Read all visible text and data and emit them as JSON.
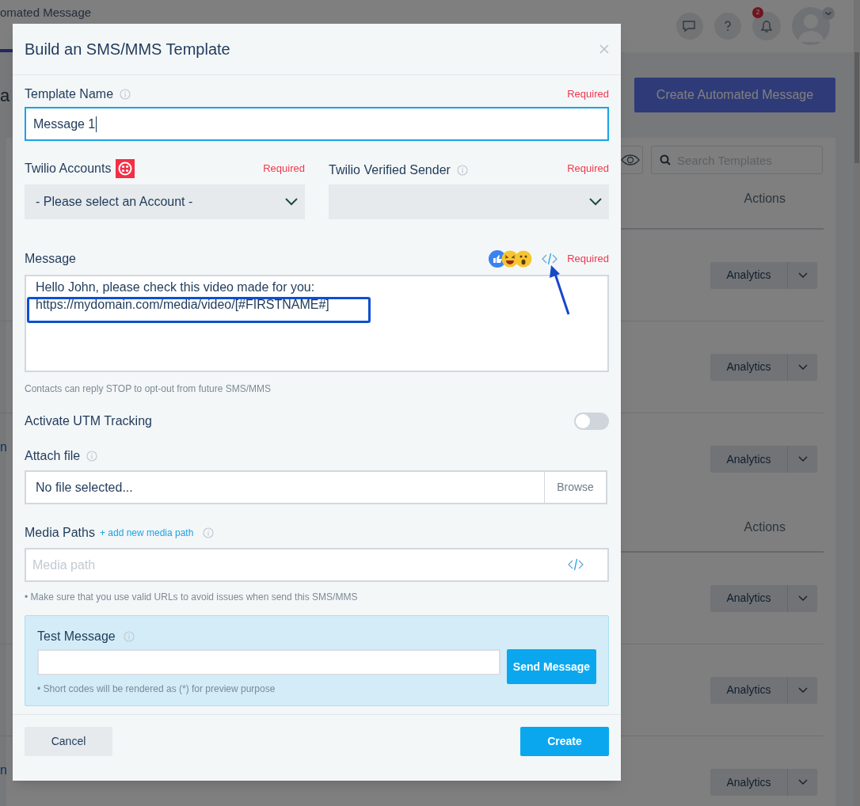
{
  "background": {
    "tab": "omated Message",
    "notification_count": "2",
    "page_title_fragment": "a",
    "create_button": "Create Automated Message",
    "search": {
      "placeholder": "Search Templates"
    },
    "sections": [
      {
        "actions_header": "Actions",
        "rows": [
          {
            "button": "Analytics"
          },
          {
            "button": "Analytics"
          },
          {
            "button": "Analytics",
            "link_fragment": "n"
          }
        ]
      },
      {
        "actions_header": "Actions",
        "rows": [
          {
            "button": "Analytics"
          },
          {
            "button": "Analytics"
          },
          {
            "button": "Analytics",
            "link_fragment": "n"
          }
        ]
      }
    ]
  },
  "modal": {
    "title": "Build an SMS/MMS Template",
    "template_name": {
      "label": "Template Name",
      "required": "Required",
      "value": "Message 1"
    },
    "twilio_accounts": {
      "label": "Twilio Accounts",
      "required": "Required",
      "value": "- Please select an Account -"
    },
    "verified_sender": {
      "label": "Twilio Verified Sender",
      "required": "Required"
    },
    "message": {
      "label": "Message",
      "required": "Required",
      "value": "Hello John, please check this video made for you:\nhttps://mydomain.com/media/video/[#FIRSTNAME#]",
      "hint": "Contacts can reply STOP to opt-out from future SMS/MMS"
    },
    "utm": {
      "label": "Activate UTM Tracking",
      "on": false
    },
    "attach": {
      "label": "Attach file",
      "value": "No file selected...",
      "button": "Browse"
    },
    "media": {
      "label": "Media Paths",
      "link": "+ add new media path",
      "placeholder": "Media path",
      "note": "• Make sure that you use valid URLs to avoid issues when send this SMS/MMS"
    },
    "test": {
      "label": "Test Message",
      "button": "Send Message",
      "note": "• Short codes will be rendered as (*) for preview purpose"
    },
    "footer": {
      "cancel": "Cancel",
      "create": "Create"
    }
  }
}
